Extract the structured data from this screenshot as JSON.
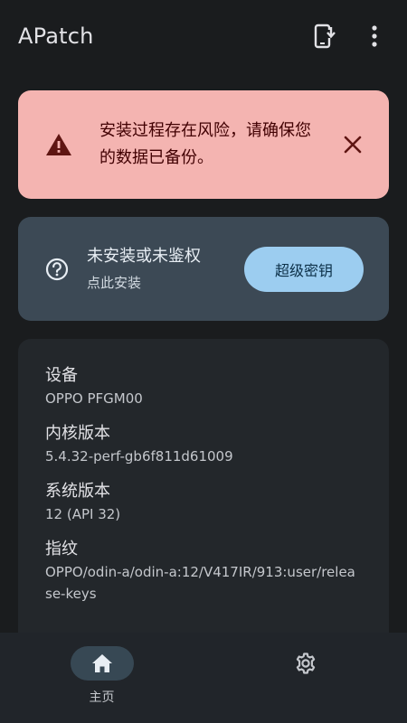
{
  "app_bar": {
    "title": "APatch"
  },
  "warning": {
    "text": "安装过程存在风险，请确保您的数据已备份。",
    "icon": "warning-triangle-icon"
  },
  "status": {
    "title": "未安装或未鉴权",
    "subtitle": "点此安装",
    "button_label": "超级密钥"
  },
  "info": {
    "items": [
      {
        "label": "设备",
        "value": "OPPO PFGM00"
      },
      {
        "label": "内核版本",
        "value": "5.4.32-perf-gb6f811d61009"
      },
      {
        "label": "系统版本",
        "value": "12 (API 32)"
      },
      {
        "label": "指纹",
        "value": "OPPO/odin-a/odin-a:12/V417IR/913:user/release-keys"
      }
    ]
  },
  "bottom_nav": {
    "home_label": "主页",
    "settings_icon": "gear-icon"
  },
  "colors": {
    "background": "#1a1c1e",
    "warning_bg": "#f4b4b1",
    "status_bg": "#3c4955",
    "accent_button": "#9ccdf0"
  }
}
